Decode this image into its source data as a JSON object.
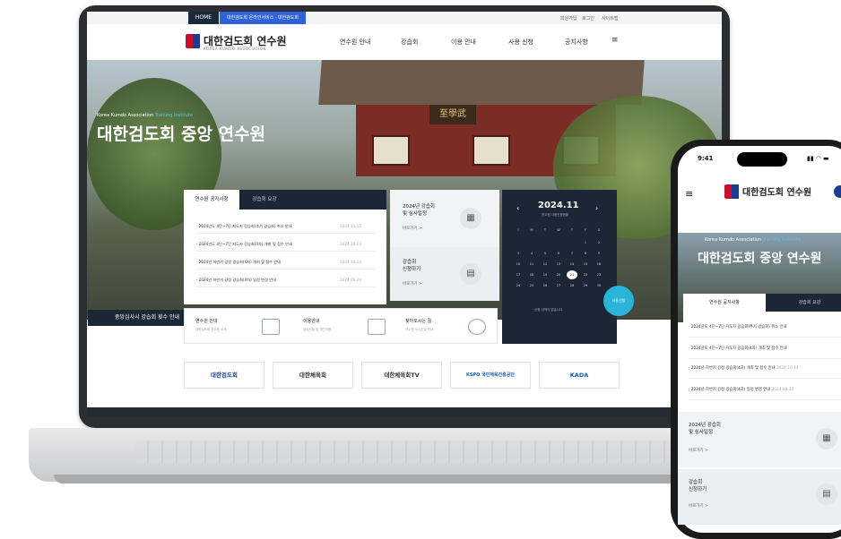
{
  "topbar": {
    "home": "HOME",
    "service": "대한검도회 온라인서비스 · 대한검도회",
    "util": [
      "회원가입",
      "로그인",
      "사이트맵"
    ]
  },
  "brand": {
    "name": "대한검도회 연수원",
    "sub": "KOREA KUMDO ASSOCIATION"
  },
  "nav": [
    "연수원 안내",
    "강습회",
    "이용 안내",
    "사용 신청",
    "공지사항"
  ],
  "hero": {
    "eyebrow": "Korea Kumdo Association",
    "eyebrow_hl": "Training Institute",
    "title": "대한검도회 중앙 연수원",
    "sign": "至學武"
  },
  "notice": {
    "tabs": [
      "연수원 공지사항",
      "강습회 요강"
    ],
    "rows": [
      {
        "text": "2024년도 4단~7단 지도자 강습회(추가 강습회) 취소 안내",
        "date": "2024.11.15"
      },
      {
        "text": "2024년도 4단~7단 지도자 강습회(4차) 개최 및 접수 안내",
        "date": "2024.10.23"
      },
      {
        "text": "2024년 하반기 강정 강습회(4차) 개최 및 접수 안내",
        "date": "2024.10.14"
      },
      {
        "text": "2024년 하반기 강정 강습회(4차) 일정 변경 안내",
        "date": "2024.09.20"
      }
    ]
  },
  "cards": {
    "schedule": {
      "title": "2024년 강습회\n및 심사일정",
      "go": "바로가기 >"
    },
    "apply": {
      "title": "강습회\n신청하기",
      "go": "바로가기 >"
    }
  },
  "calendar": {
    "month": "2024.11",
    "sub": "연수원 사용신청현황",
    "empty": "신청 내역이 없습니다.",
    "apply": "사용신청",
    "weekdays": [
      "S",
      "M",
      "T",
      "W",
      "T",
      "F",
      "S"
    ]
  },
  "recruit": "중앙심사시 강습회 횟수 안내",
  "quick": [
    {
      "title": "연수원 안내",
      "sub": "대한검도회 연수원 소개"
    },
    {
      "title": "이용안내",
      "sub": "강습신청 및 개인이용"
    },
    {
      "title": "찾아오시는 길",
      "sub": "연수원 오시는길 안내"
    }
  ],
  "partners": [
    "대한검도회",
    "대한체육회",
    "대한체육회TV",
    "KSPO 국민체육진흥공단",
    "KADA"
  ],
  "phone": {
    "time": "9:41",
    "brand": "대한검도회 연수원",
    "hero_small": "Korea Kumdo Association",
    "hero_hl": "Training Institute",
    "hero_title": "대한검도회 중앙 연수원",
    "tabs": [
      "연수원 공지사항",
      "강습회 요강"
    ],
    "rows": [
      {
        "text": "2024년도 4단~7단 지도자 강습회(추가 강습회) 취소 안내",
        "date": ""
      },
      {
        "text": "2024년도 4단~7단 지도자 강습회(4차) 개최 및 접수 안내",
        "date": ""
      },
      {
        "text": "2024년 하반기 강정 강습회(4차) 개최 및 접수 안내",
        "date": "2024.10.14"
      },
      {
        "text": "2024년 하반기 강정 강습회(4차) 일정 변경 안내",
        "date": "2024.03.20"
      }
    ],
    "card1": {
      "title": "2024년 강습회\n및 심사일정",
      "go": "바로가기 >"
    },
    "card2": {
      "title": "강습회\n신청하기",
      "go": "바로가기 >"
    }
  }
}
